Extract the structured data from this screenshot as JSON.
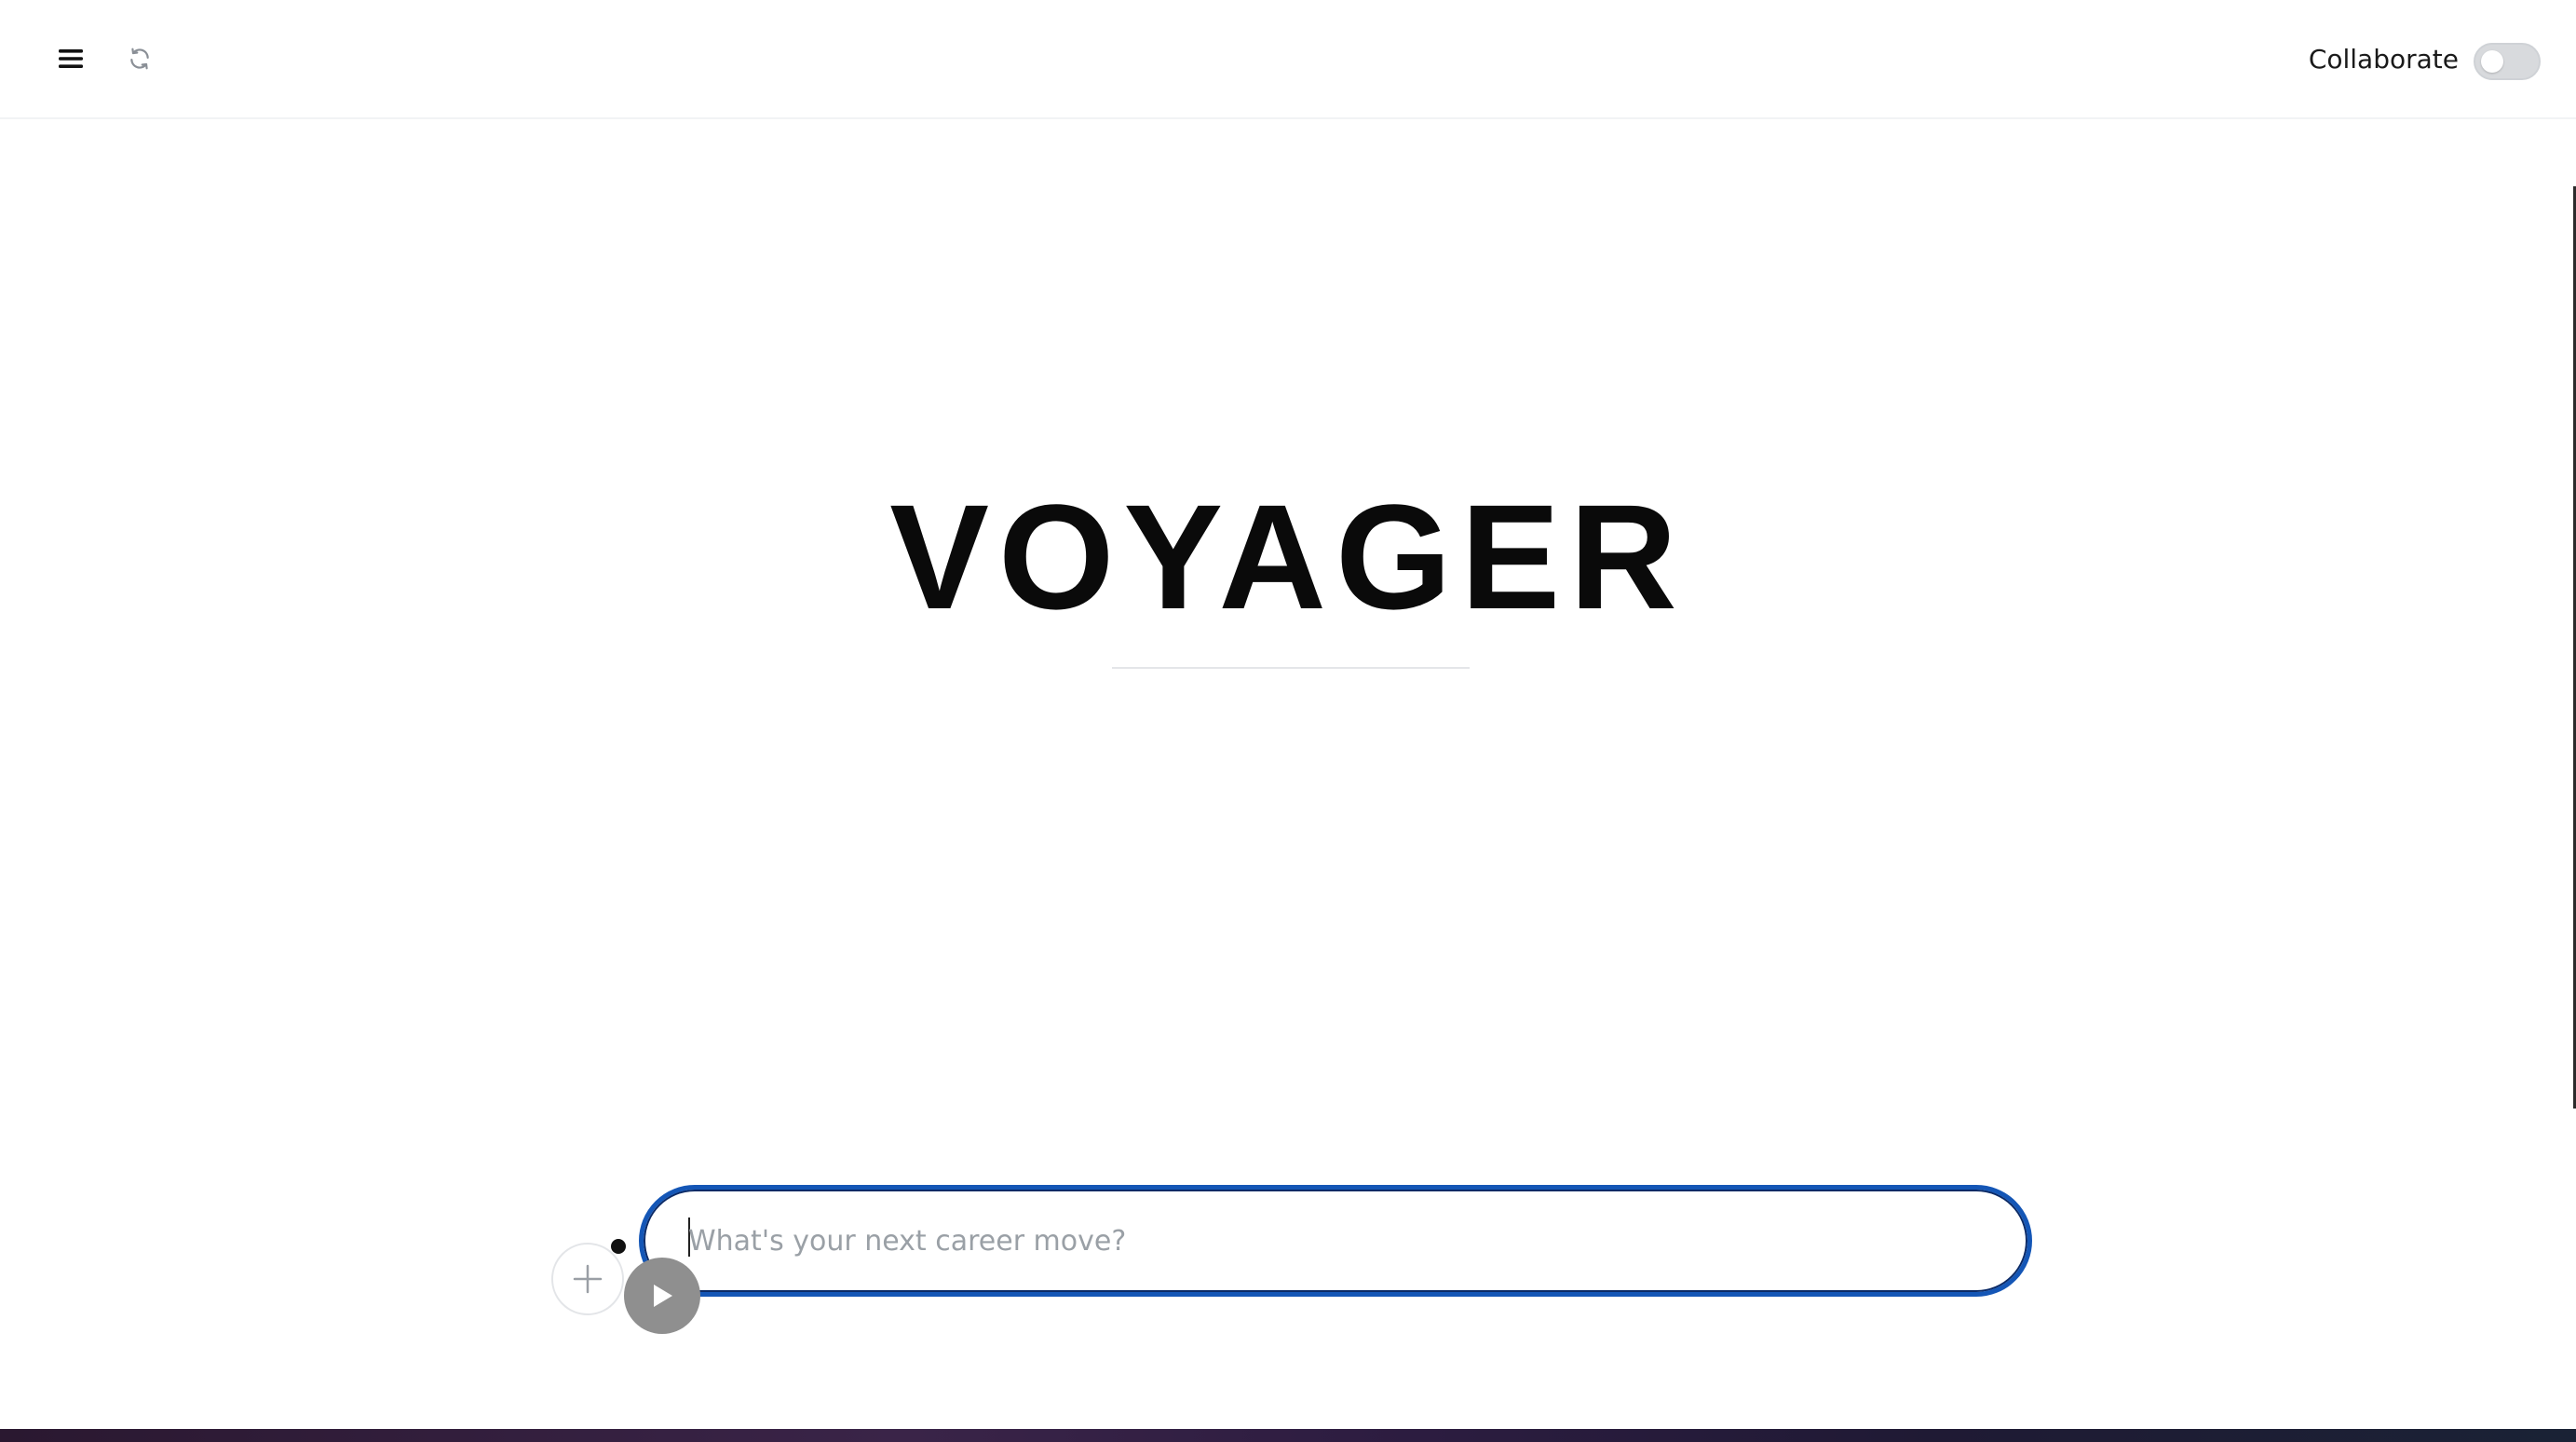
{
  "header": {
    "menu_icon": "hamburger-menu-icon",
    "refresh_icon": "refresh-icon",
    "collaborate_label": "Collaborate",
    "collaborate_enabled": false
  },
  "main": {
    "title": "VOYAGER"
  },
  "composer": {
    "placeholder": "What's your next career move?",
    "value": "",
    "add_icon": "plus-icon",
    "send_icon": "play-icon"
  },
  "colors": {
    "accent": "#1456b6",
    "toggle_off": "#d8dadd",
    "send_button": "#8f8f8f"
  }
}
